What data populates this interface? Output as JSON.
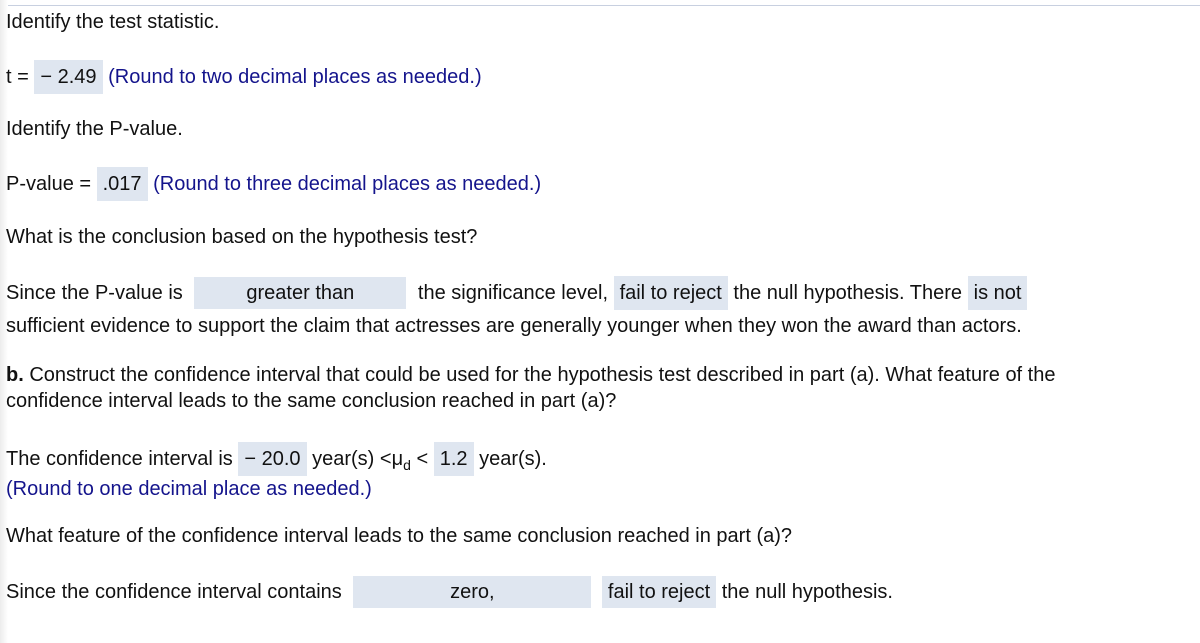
{
  "test_statistic": {
    "heading": "Identify the test statistic.",
    "label": "t =",
    "value": "− 2.49",
    "hint": "(Round to two decimal places as needed.)"
  },
  "p_value": {
    "heading": "Identify the P-value.",
    "label": "P-value =",
    "value": ".017",
    "hint": "(Round to three decimal places as needed.)"
  },
  "conclusion": {
    "question": "What is the conclusion based on the hypothesis test?",
    "part1": "Since the P-value is",
    "comparison": "greater than",
    "part2": "the significance level,",
    "decision": "fail to reject",
    "part3": "the null hypothesis. There",
    "evidence": "is not",
    "line2": "sufficient evidence to support the claim that actresses are generally younger when they won the award than actors."
  },
  "part_b": {
    "label": "b.",
    "question": "Construct the confidence interval that could be used for the hypothesis test described in part (a). What feature of the",
    "question_line2": "confidence interval leads to the same conclusion reached in part (a)?"
  },
  "confidence_interval": {
    "prefix": "The confidence interval is",
    "lower": "− 20.0",
    "mid": "year(s) <",
    "mu": "μ",
    "mu_sub": "d",
    "lt": "<",
    "upper": "1.2",
    "suffix": "year(s).",
    "hint": "(Round to one decimal place as needed.)"
  },
  "feature": {
    "question": "What feature of the confidence interval leads to the same conclusion reached in part (a)?",
    "prefix": "Since the confidence interval contains",
    "contains": "zero,",
    "decision": "fail to reject",
    "suffix": "the null hypothesis."
  }
}
